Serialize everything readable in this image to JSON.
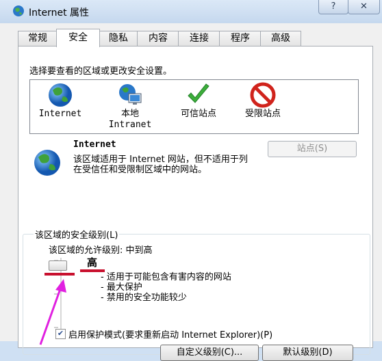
{
  "window": {
    "title": "Internet 属性",
    "help_label": "?",
    "close_label": "✕"
  },
  "tabs": [
    {
      "label": "常规"
    },
    {
      "label": "安全"
    },
    {
      "label": "隐私"
    },
    {
      "label": "内容"
    },
    {
      "label": "连接"
    },
    {
      "label": "程序"
    },
    {
      "label": "高级"
    }
  ],
  "security": {
    "zone_prompt": "选择要查看的区域或更改安全设置。",
    "zones": [
      {
        "label": "Internet",
        "icon": "globe-icon"
      },
      {
        "label": "本地\nIntranet",
        "label1": "本地",
        "label2": "Intranet",
        "icon": "intranet-icon"
      },
      {
        "label": "可信站点",
        "icon": "checkmark-icon"
      },
      {
        "label": "受限站点",
        "icon": "no-entry-icon"
      }
    ],
    "selected_zone": {
      "title": "Internet",
      "description": "该区域适用于 Internet 网站，但不适用于列在受信任和受限制区域中的网站。"
    },
    "sites_button": "站点(S)",
    "level_group_title": "该区域的安全级别(L)",
    "allowed_levels": "该区域的允许级别: 中到高",
    "level_name": "高",
    "level_bullets": [
      "- 适用于可能包含有害内容的网站",
      "- 最大保护",
      "- 禁用的安全功能较少"
    ],
    "protected_mode": {
      "label": "启用保护模式(要求重新启动 Internet Explorer)(P)",
      "checked": true
    },
    "custom_level_button": "自定义级别(C)...",
    "default_level_button": "默认级别(D)"
  },
  "colors": {
    "annotation_red": "#c8102e",
    "arrow_magenta": "#e020e0",
    "titlebar": "#c5d8ee"
  }
}
